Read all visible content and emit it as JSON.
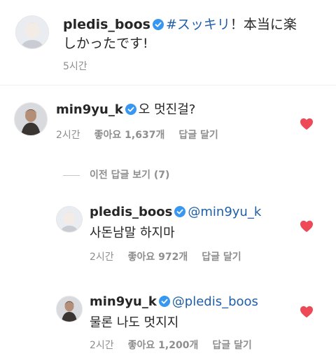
{
  "caption": {
    "username": "pledis_boos",
    "hashtag": "#スッキリ",
    "text": "！本当に楽しかったです!",
    "time": "5시간"
  },
  "comments": [
    {
      "username": "min9yu_k",
      "text": "오 멋진걸?",
      "time": "2시간",
      "likes": "좋아요 1,637개",
      "reply_label": "답글 달기"
    }
  ],
  "view_replies": "이전 답글 보기 (7)",
  "replies": [
    {
      "username": "pledis_boos",
      "mention": "@min9yu_k",
      "text": "사돈남말 하지마",
      "time": "2시간",
      "likes": "좋아요 972개",
      "reply_label": "답글 달기"
    },
    {
      "username": "min9yu_k",
      "mention": "@pledis_boos",
      "text": "물론 나도 멋지지",
      "time": "2시간",
      "likes": "좋아요 1,200개",
      "reply_label": "답글 달기"
    }
  ],
  "colors": {
    "heart": "#ed4956",
    "verified": "#3897f0",
    "link": "#1f5fa8",
    "meta": "#8e8e8e"
  },
  "icons": {
    "verified": "verified-badge-icon",
    "heart": "heart-filled-icon"
  }
}
